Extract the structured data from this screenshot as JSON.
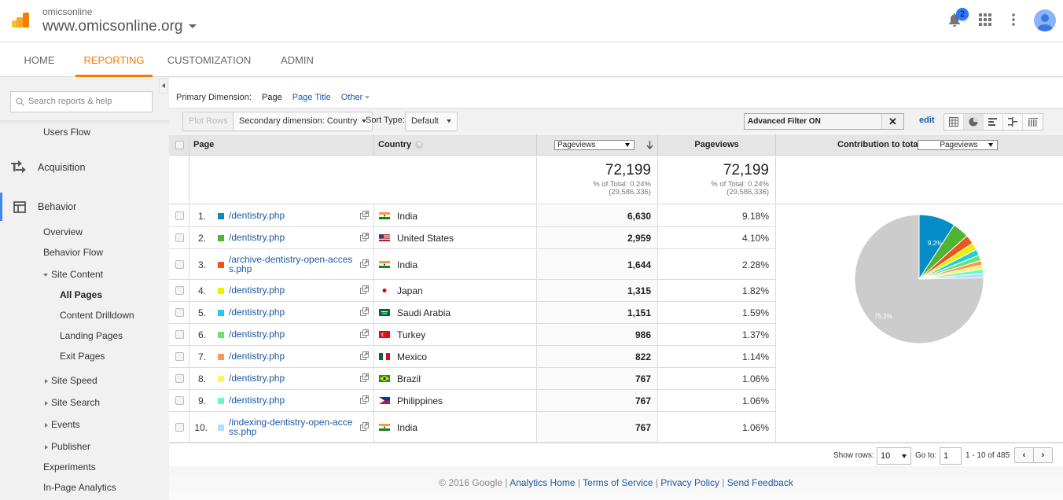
{
  "header": {
    "account_small": "omicsonline",
    "account_property": "www.omicsonline.org",
    "notification_count": "2"
  },
  "nav": {
    "tabs": [
      {
        "label": "HOME",
        "active": false
      },
      {
        "label": "REPORTING",
        "active": true
      },
      {
        "label": "CUSTOMIZATION",
        "active": false
      },
      {
        "label": "ADMIN",
        "active": false
      }
    ]
  },
  "sidebar": {
    "search_placeholder": "Search reports & help",
    "items": {
      "users_flow": "Users Flow",
      "acquisition": "Acquisition",
      "behavior": "Behavior",
      "overview": "Overview",
      "behavior_flow": "Behavior Flow",
      "site_content": "Site Content",
      "all_pages": "All Pages",
      "content_drilldown": "Content Drilldown",
      "landing_pages": "Landing Pages",
      "exit_pages": "Exit Pages",
      "site_speed": "Site Speed",
      "site_search": "Site Search",
      "events": "Events",
      "publisher": "Publisher",
      "experiments": "Experiments",
      "in_page_analytics": "In-Page Analytics"
    }
  },
  "report": {
    "primary_dimension_label": "Primary Dimension:",
    "primary_dimension_active": "Page",
    "primary_dimension_options": [
      "Page Title",
      "Other"
    ],
    "toolbar": {
      "plot_rows": "Plot Rows",
      "secondary_dimension": "Secondary dimension: Country",
      "sort_type_label": "Sort Type:",
      "sort_type_value": "Default",
      "filter_text": "Advanced Filter ON",
      "edit_label": "edit"
    },
    "columns": {
      "page": "Page",
      "country": "Country",
      "metric_select": "Pageviews",
      "pageviews": "Pageviews",
      "contribution_label": "Contribution to total:",
      "contribution_select": "Pageviews"
    },
    "totals": {
      "value": "72,199",
      "pct_of_total": "% of Total: 0.24%",
      "grand_total": "(29,586,336)"
    },
    "rows": [
      {
        "idx": "1.",
        "page": "/dentistry.php",
        "color": "#058dc7",
        "country": "India",
        "flag": "in",
        "pageviews": "6,630",
        "pct": "9.18%"
      },
      {
        "idx": "2.",
        "page": "/dentistry.php",
        "color": "#50b432",
        "country": "United States",
        "flag": "us",
        "pageviews": "2,959",
        "pct": "4.10%"
      },
      {
        "idx": "3.",
        "page": "/archive-dentistry-open-acces",
        "page2": "s.php",
        "color": "#ed561b",
        "country": "India",
        "flag": "in",
        "pageviews": "1,644",
        "pct": "2.28%"
      },
      {
        "idx": "4.",
        "page": "/dentistry.php",
        "color": "#edef00",
        "country": "Japan",
        "flag": "jp",
        "pageviews": "1,315",
        "pct": "1.82%"
      },
      {
        "idx": "5.",
        "page": "/dentistry.php",
        "color": "#24cbe5",
        "country": "Saudi Arabia",
        "flag": "sa",
        "pageviews": "1,151",
        "pct": "1.59%"
      },
      {
        "idx": "6.",
        "page": "/dentistry.php",
        "color": "#64e572",
        "country": "Turkey",
        "flag": "tr",
        "pageviews": "986",
        "pct": "1.37%"
      },
      {
        "idx": "7.",
        "page": "/dentistry.php",
        "color": "#ff9655",
        "country": "Mexico",
        "flag": "mx",
        "pageviews": "822",
        "pct": "1.14%"
      },
      {
        "idx": "8.",
        "page": "/dentistry.php",
        "color": "#fff263",
        "country": "Brazil",
        "flag": "br",
        "pageviews": "767",
        "pct": "1.06%"
      },
      {
        "idx": "9.",
        "page": "/dentistry.php",
        "color": "#6af9c4",
        "country": "Philippines",
        "flag": "ph",
        "pageviews": "767",
        "pct": "1.06%"
      },
      {
        "idx": "10.",
        "page": "/indexing-dentistry-open-acce",
        "page2": "ss.php",
        "color": "#b2deff",
        "country": "India",
        "flag": "in",
        "pageviews": "767",
        "pct": "1.06%"
      }
    ],
    "pager": {
      "show_rows_label": "Show rows:",
      "show_rows_value": "10",
      "goto_label": "Go to:",
      "goto_value": "1",
      "range": "1 - 10 of 485"
    }
  },
  "chart_data": {
    "type": "pie",
    "title": "Contribution to total: Pageviews",
    "labels": [
      "/dentistry.php (India)",
      "/dentistry.php (United States)",
      "/archive-dentistry-open-access.php (India)",
      "/dentistry.php (Japan)",
      "/dentistry.php (Saudi Arabia)",
      "/dentistry.php (Turkey)",
      "/dentistry.php (Mexico)",
      "/dentistry.php (Brazil)",
      "/dentistry.php (Philippines)",
      "/indexing-dentistry-open-access.php (India)",
      "Other"
    ],
    "values": [
      9.18,
      4.1,
      2.28,
      1.82,
      1.59,
      1.37,
      1.14,
      1.06,
      1.06,
      1.06,
      75.3
    ],
    "colors": [
      "#058dc7",
      "#50b432",
      "#ed561b",
      "#edef00",
      "#24cbe5",
      "#64e572",
      "#ff9655",
      "#fff263",
      "#6af9c4",
      "#b2deff",
      "#cccccc"
    ],
    "slice_labels": {
      "first": "9.2%",
      "other": "75.3%"
    }
  },
  "footer": {
    "copyright": "© 2016 Google",
    "links": [
      "Analytics Home",
      "Terms of Service",
      "Privacy Policy",
      "Send Feedback"
    ]
  }
}
